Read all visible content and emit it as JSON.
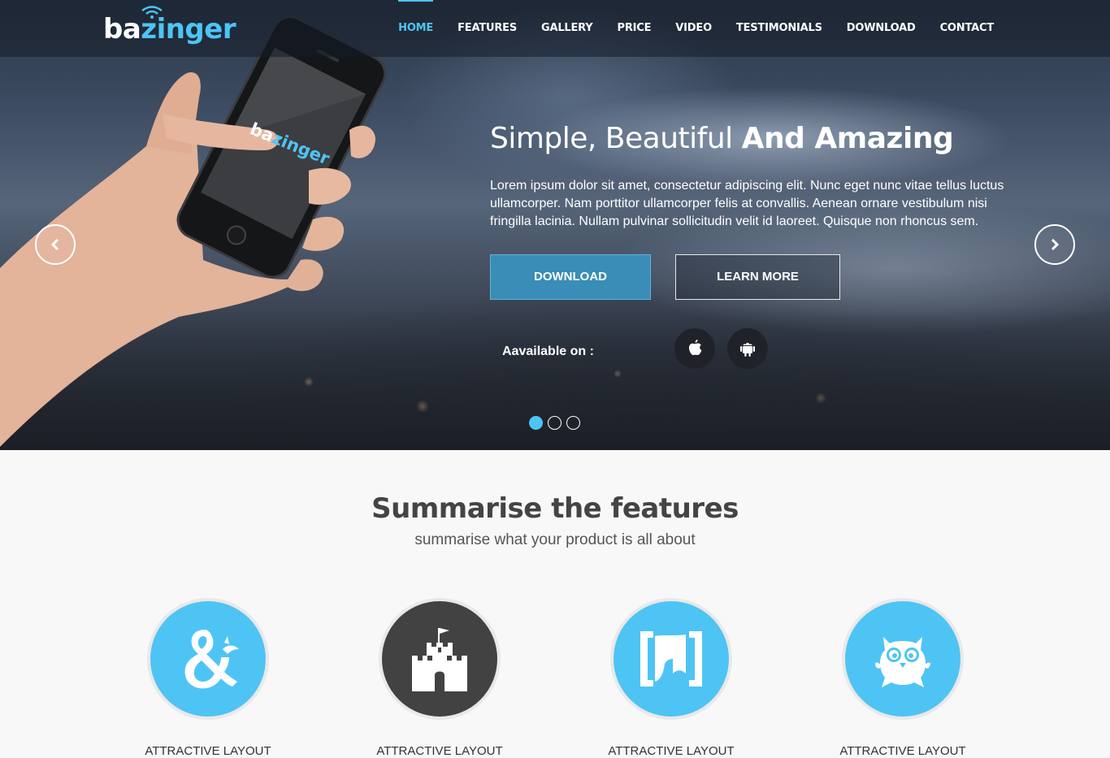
{
  "brand": {
    "name_part1": "ba",
    "name_part2": "zinger",
    "accent_color": "#4ec4f5"
  },
  "nav": {
    "items": [
      "HOME",
      "FEATURES",
      "GALLERY",
      "PRICE",
      "VIDEO",
      "TESTIMONIALS",
      "DOWNLOAD",
      "CONTACT"
    ],
    "active": "HOME"
  },
  "hero": {
    "title_light": "Simple, Beautiful ",
    "title_bold": "And Amazing",
    "text": "Lorem ipsum dolor sit amet, consectetur adipiscing elit. Nunc eget nunc vitae tellus luctus ullamcorper. Nam porttitor ullamcorper felis at convallis. Aenean ornare vestibulum nisi fringilla lacinia. Nullam pulvinar sollicitudin velit id laoreet. Quisque non rhoncus sem.",
    "download_label": "DOWNLOAD",
    "learn_more_label": "LEARN MORE",
    "available_label": "Aavailable on :",
    "stores": [
      "apple-icon",
      "android-icon"
    ],
    "phone_brand_part1": "ba",
    "phone_brand_part2": "zinger",
    "slides": {
      "count": 3,
      "active": 1
    }
  },
  "features": {
    "title": "Summarise the features",
    "subtitle": "summarise what your product is all about",
    "items": [
      {
        "icon": "dragon-ampersand-icon",
        "label": "ATTRACTIVE LAYOUT",
        "style": "blue"
      },
      {
        "icon": "castle-icon",
        "label": "ATTRACTIVE LAYOUT",
        "style": "dark"
      },
      {
        "icon": "bracket-logo-icon",
        "label": "ATTRACTIVE LAYOUT",
        "style": "blue"
      },
      {
        "icon": "owl-icon",
        "label": "ATTRACTIVE LAYOUT",
        "style": "blue"
      }
    ]
  }
}
